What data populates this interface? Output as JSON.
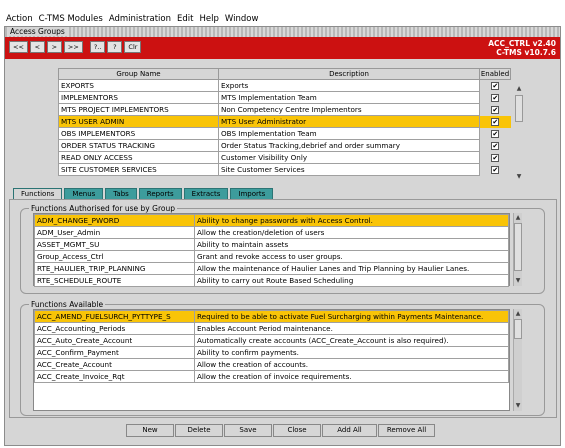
{
  "menubar": [
    "Action",
    "C-TMS Modules",
    "Administration",
    "Edit",
    "Help",
    "Window"
  ],
  "window": {
    "title": "Access Groups"
  },
  "toolbar": {
    "nav_buttons": [
      "<<",
      "<",
      ">",
      ">>",
      "?..",
      "?",
      "Clr"
    ],
    "app_name": "ACC_CTRL v2.40",
    "version": "C-TMS v10.7.6"
  },
  "groups": {
    "columns": {
      "name": "Group Name",
      "description": "Description",
      "enabled": "Enabled"
    },
    "rows": [
      {
        "name": "EXPORTS",
        "description": "Exports",
        "enabled": true,
        "selected": false
      },
      {
        "name": "IMPLEMENTORS",
        "description": "MTS Implementation Team",
        "enabled": true,
        "selected": false
      },
      {
        "name": "MTS PROJECT IMPLEMENTORS",
        "description": "Non Competency Centre Implementors",
        "enabled": true,
        "selected": false
      },
      {
        "name": "MTS USER ADMIN",
        "description": "MTS User Administrator",
        "enabled": true,
        "selected": true
      },
      {
        "name": "OBS IMPLEMENTORS",
        "description": "OBS Implementation Team",
        "enabled": true,
        "selected": false
      },
      {
        "name": "ORDER STATUS TRACKING",
        "description": "Order Status Tracking,debrief and order summary",
        "enabled": true,
        "selected": false
      },
      {
        "name": "READ ONLY ACCESS",
        "description": "Customer Visibility Only",
        "enabled": true,
        "selected": false
      },
      {
        "name": "SITE CUSTOMER SERVICES",
        "description": "Site Customer Services",
        "enabled": true,
        "selected": false
      }
    ]
  },
  "tabs": [
    "Functions",
    "Menus",
    "Tabs",
    "Reports",
    "Extracts",
    "Imports"
  ],
  "active_tab": "Functions",
  "authorised": {
    "legend": "Functions Authorised for use by Group",
    "rows": [
      {
        "name": "ADM_CHANGE_PWORD",
        "description": "Ability to change passwords with Access Control.",
        "selected": true
      },
      {
        "name": "ADM_User_Admin",
        "description": "Allow the creation/deletion of users",
        "selected": false
      },
      {
        "name": "ASSET_MGMT_SU",
        "description": "Ability to maintain assets",
        "selected": false
      },
      {
        "name": "Group_Access_Ctrl",
        "description": "Grant and revoke access to user groups.",
        "selected": false
      },
      {
        "name": "RTE_HAULIER_TRIP_PLANNING",
        "description": "Allow the maintenance of Haulier Lanes and Trip Planning by Haulier Lanes.",
        "selected": false
      },
      {
        "name": "RTE_SCHEDULE_ROUTE",
        "description": "Ability to carry out Route Based Scheduling",
        "selected": false
      }
    ]
  },
  "available": {
    "legend": "Functions Available",
    "rows": [
      {
        "name": "ACC_AMEND_FUELSURCH_PYTTYPE_S",
        "description": "Required to be able to activate Fuel Surcharging within Payments Maintenance.",
        "selected": true
      },
      {
        "name": "ACC_Accounting_Periods",
        "description": "Enables Account Period maintenance.",
        "selected": false
      },
      {
        "name": "ACC_Auto_Create_Account",
        "description": "Automatically create accounts (ACC_Create_Account is also required).",
        "selected": false
      },
      {
        "name": "ACC_Confirm_Payment",
        "description": "Ability to confirm payments.",
        "selected": false
      },
      {
        "name": "ACC_Create_Account",
        "description": "Allow the creation of accounts.",
        "selected": false
      },
      {
        "name": "ACC_Create_Invoice_Rqt",
        "description": "Allow the creation of invoice requirements.",
        "selected": false
      }
    ]
  },
  "buttons": {
    "new": "New",
    "delete": "Delete",
    "save": "Save",
    "close": "Close",
    "add_all": "Add All",
    "remove_all": "Remove All"
  },
  "colors": {
    "toolbar": "#cc1111",
    "selection": "#f9c407",
    "tab": "#3d9c9c"
  }
}
